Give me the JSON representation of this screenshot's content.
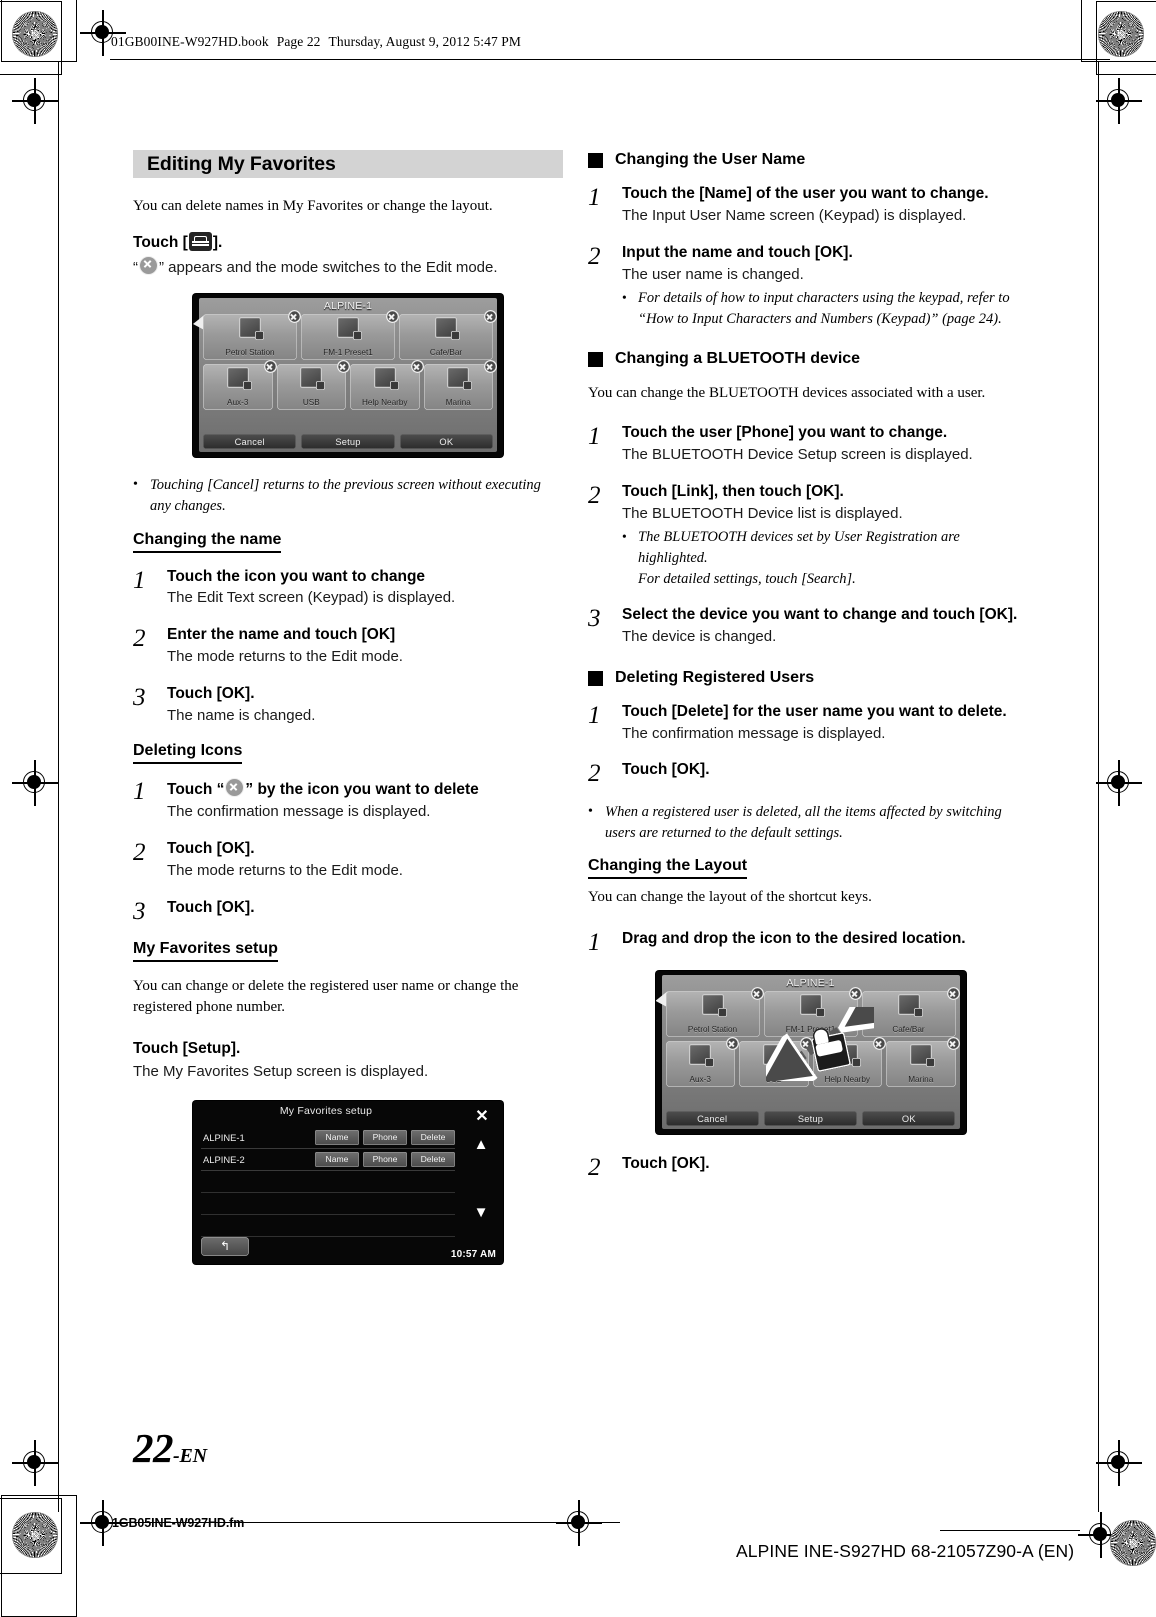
{
  "header": {
    "file_line": "01GB00INE-W927HD.book",
    "page_label": "Page 22",
    "date_line": "Thursday, August 9, 2012  5:47 PM"
  },
  "footer": {
    "left_file": "1GB05INE-W927HD.fm",
    "right_model": "ALPINE INE-S927HD 68-21057Z90-A (EN)",
    "page_number": "22",
    "page_lang": "-EN"
  },
  "left_column": {
    "section_title": "Editing My Favorites",
    "intro": "You can delete names in My Favorites or change the layout.",
    "touch_edit_label_pre": "Touch [",
    "touch_edit_label_post": "].",
    "edit_mode_pre": "“",
    "edit_mode_post": "” appears and the mode switches to the Edit mode.",
    "note_cancel": "Touching [Cancel] returns to the previous screen without executing any changes.",
    "changing_name": {
      "heading": "Changing the name",
      "steps": [
        {
          "n": "1",
          "title": "Touch the icon you want to change",
          "sub": "The Edit Text screen (Keypad) is displayed."
        },
        {
          "n": "2",
          "title": "Enter the name and touch [OK]",
          "sub": "The mode returns to the Edit mode."
        },
        {
          "n": "3",
          "title": "Touch [OK].",
          "sub": "The name is changed."
        }
      ]
    },
    "deleting_icons": {
      "heading": "Deleting Icons",
      "step1_pre": "Touch “",
      "step1_post": "” by the icon you want to delete",
      "step1_sub": "The confirmation message is displayed.",
      "steps": [
        {
          "n": "2",
          "title": "Touch [OK].",
          "sub": "The mode returns to the Edit mode."
        },
        {
          "n": "3",
          "title": "Touch [OK].",
          "sub": ""
        }
      ]
    },
    "my_favorites_setup": {
      "heading": "My Favorites setup",
      "body": "You can change or delete the registered user name or change the registered phone number.",
      "touch_setup": "Touch [Setup].",
      "touch_setup_sub": "The My Favorites Setup screen is displayed."
    }
  },
  "right_column": {
    "changing_user_name": {
      "heading": "Changing the User Name",
      "steps": [
        {
          "n": "1",
          "title": "Touch the [Name] of the user you want to change.",
          "sub": "The Input User Name screen (Keypad) is displayed."
        },
        {
          "n": "2",
          "title": "Input the name and touch [OK].",
          "sub": "The user name is changed."
        }
      ],
      "note": "For details of how to input characters using the keypad, refer to “How to Input Characters and Numbers (Keypad)” (page 24)."
    },
    "changing_bluetooth": {
      "heading": "Changing a BLUETOOTH device",
      "intro": "You can change the BLUETOOTH devices associated with a user.",
      "steps": [
        {
          "n": "1",
          "title": "Touch the user [Phone] you want to change.",
          "sub": "The BLUETOOTH Device Setup screen is displayed."
        },
        {
          "n": "2",
          "title": "Touch [Link], then touch [OK].",
          "sub": "The BLUETOOTH Device list is displayed."
        },
        {
          "n": "3",
          "title": "Select the device you want to change and touch [OK].",
          "sub": "The device is changed."
        }
      ],
      "note_line1": "The BLUETOOTH devices set by User Registration are highlighted.",
      "note_line2": "For detailed settings, touch [Search]."
    },
    "deleting_users": {
      "heading": "Deleting Registered Users",
      "steps": [
        {
          "n": "1",
          "title": "Touch [Delete] for the user name you want to delete.",
          "sub": "The confirmation message is displayed."
        },
        {
          "n": "2",
          "title": "Touch [OK].",
          "sub": ""
        }
      ],
      "note": "When a registered user is deleted, all the items affected by switching users are returned to the default settings."
    },
    "changing_layout": {
      "heading": "Changing the Layout",
      "intro": "You can change the layout of the shortcut keys.",
      "step1": "Drag and drop the icon to the desired location.",
      "step2": "Touch [OK]."
    }
  },
  "favorites_screen": {
    "title": "ALPINE-1",
    "row1": [
      {
        "label": "Petrol Station"
      },
      {
        "label": "FM-1 Preset1"
      },
      {
        "label": "Cafe/Bar"
      }
    ],
    "row2": [
      {
        "label": "Aux-3"
      },
      {
        "label": "USB"
      },
      {
        "label": "Help Nearby"
      },
      {
        "label": "Marina"
      }
    ],
    "buttons": [
      "Cancel",
      "Setup",
      "OK"
    ]
  },
  "setup_screen": {
    "title": "My Favorites setup",
    "rows": [
      {
        "name": "ALPINE-1",
        "buttons": [
          "Name",
          "Phone",
          "Delete"
        ]
      },
      {
        "name": "ALPINE-2",
        "buttons": [
          "Name",
          "Phone",
          "Delete"
        ]
      }
    ],
    "clock": "10:57 AM",
    "close_icon": "✕",
    "up_icon": "▲",
    "down_icon": "▼",
    "back_icon": "↰"
  },
  "colors": {
    "section_bar": "#d3d3d3",
    "text": "#000000",
    "screen_bg": "#060606"
  }
}
